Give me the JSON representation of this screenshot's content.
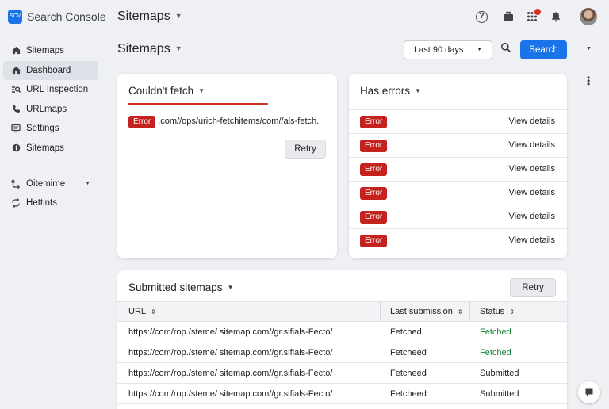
{
  "app": {
    "logo_text": "SCV",
    "name": "Search Console"
  },
  "header": {
    "title": "Sitemaps"
  },
  "sidebar": {
    "items": [
      {
        "label": "Sitemaps",
        "icon": "home-icon"
      },
      {
        "label": "Dashboard",
        "icon": "home-icon",
        "active": true
      },
      {
        "label": "URL Inspection",
        "icon": "inspection-icon"
      },
      {
        "label": "URLmaps",
        "icon": "phone-icon"
      },
      {
        "label": "Settings",
        "icon": "monitor-icon"
      },
      {
        "label": "Sitemaps",
        "icon": "info-icon"
      }
    ],
    "secondary": [
      {
        "label": "Oitemime",
        "icon": "route-icon",
        "has_caret": true
      },
      {
        "label": "Hettints",
        "icon": "sync-icon"
      }
    ]
  },
  "page": {
    "title": "Sitemaps",
    "date_range": "Last 90 days",
    "search_label": "Search"
  },
  "fetch_card": {
    "title": "Couldn't fetch",
    "error_label": "Error",
    "error_url": ".com//ops/urich-fetchitems/com//als-fetch.",
    "retry_label": "Retry"
  },
  "errors_card": {
    "title": "Has errors",
    "rows": [
      {
        "chip": "Error",
        "link": "View details"
      },
      {
        "chip": "Error",
        "link": "View details"
      },
      {
        "chip": "Error",
        "link": "View details"
      },
      {
        "chip": "Error",
        "link": "View details"
      },
      {
        "chip": "Error",
        "link": "View details"
      },
      {
        "chip": "Error",
        "link": "View details"
      }
    ]
  },
  "sitemaps_card": {
    "title": "Submitted sitemaps",
    "retry_label": "Retry",
    "columns": [
      "URL",
      "Last submission",
      "Status"
    ],
    "rows": [
      {
        "url": "https://com/rop./steme/ sitemap.com//gr.sifials-Fecto/",
        "last_submission": "Fetched",
        "status": "Fetched"
      },
      {
        "url": "https://com/rop./steme/ sitemap.com//gr.sifials-Fecto/",
        "last_submission": "Fetcheed",
        "status": "Fetched"
      },
      {
        "url": "https://com/rop./steme/ sitemap.com//gr.sifials-Fecto/",
        "last_submission": "Fetcheed",
        "status": "Submitted"
      },
      {
        "url": "https://com/rop./steme/ sitemap.com//gr.sifials-Fecto/",
        "last_submission": "Fetcheed",
        "status": "Submitted"
      }
    ]
  },
  "colors": {
    "primary": "#1a73e8",
    "error": "#c5221f",
    "success": "#188038",
    "background": "#eef0f4"
  }
}
